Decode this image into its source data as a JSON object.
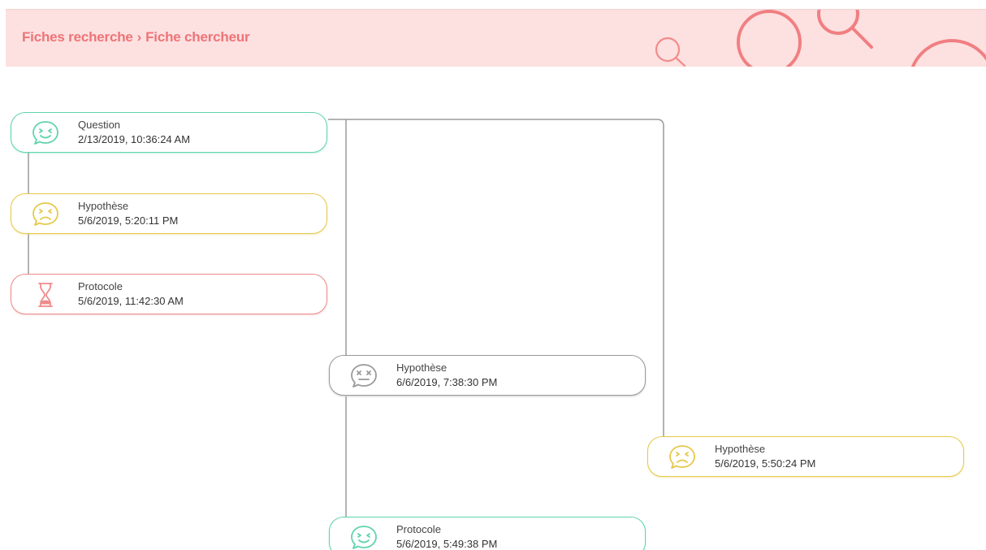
{
  "header": {
    "crumb_1": "Fiches recherche",
    "separator": "›",
    "crumb_2": "Fiche chercheur",
    "background_color": "#fde0e0",
    "text_color": "#ee7477"
  },
  "colors": {
    "green": "#5fd3ae",
    "yellow": "#e6c84b",
    "red": "#ee8b8b",
    "gray": "#9a9a9a",
    "connector": "#9a9a9a"
  },
  "nodes": [
    {
      "id": "n1",
      "title": "Question",
      "date": "2/13/2019, 10:36:24 AM",
      "color": "green",
      "icon": "happy-speech-bubble-icon"
    },
    {
      "id": "n2",
      "title": "Hypothèse",
      "date": "5/6/2019, 5:20:11 PM",
      "color": "yellow",
      "icon": "sad-speech-bubble-icon"
    },
    {
      "id": "n3",
      "title": "Protocole",
      "date": "5/6/2019, 11:42:30 AM",
      "color": "red",
      "icon": "hourglass-icon"
    },
    {
      "id": "n4",
      "title": "Hypothèse",
      "date": "6/6/2019, 7:38:30 PM",
      "color": "gray",
      "icon": "dead-speech-bubble-icon"
    },
    {
      "id": "n5",
      "title": "Hypothèse",
      "date": "5/6/2019, 5:50:24 PM",
      "color": "yellow",
      "icon": "sad-speech-bubble-icon"
    },
    {
      "id": "n6",
      "title": "Protocole",
      "date": "5/6/2019, 5:49:38 PM",
      "color": "green",
      "icon": "happy-speech-bubble-icon"
    }
  ]
}
